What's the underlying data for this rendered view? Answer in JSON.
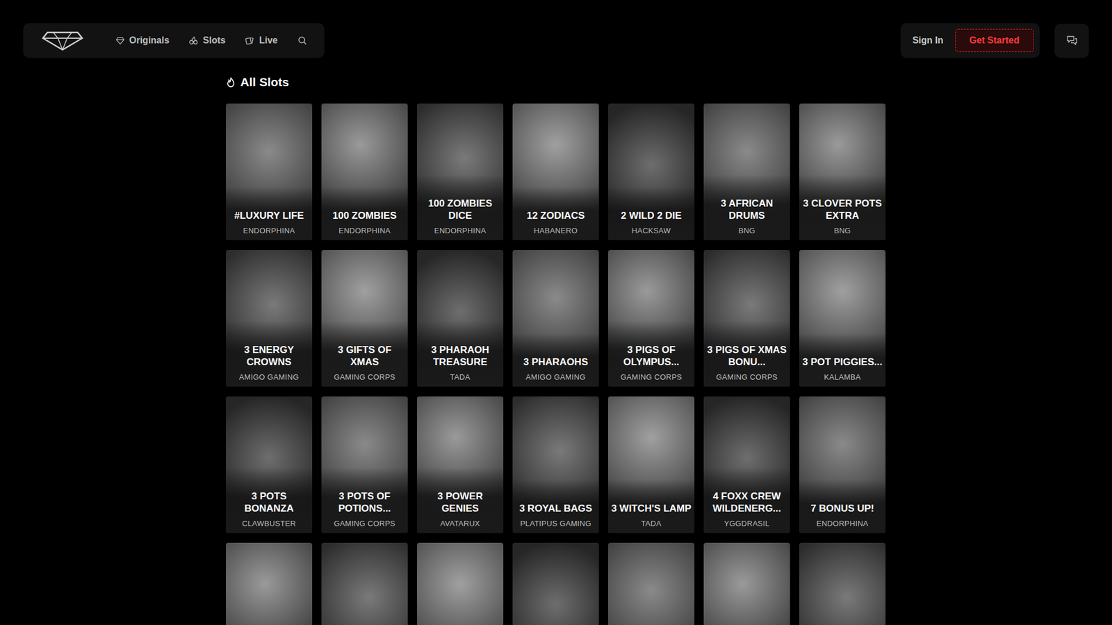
{
  "header": {
    "nav": [
      {
        "label": "Originals",
        "icon": "gem",
        "selected": false
      },
      {
        "label": "Slots",
        "icon": "cherries",
        "selected": false
      },
      {
        "label": "Live",
        "icon": "cards",
        "selected": false
      }
    ],
    "sign_in": "Sign In",
    "get_started": "Get Started"
  },
  "section": {
    "title": "All Slots"
  },
  "cards": [
    {
      "title": "#LUXURY LIFE",
      "provider": "ENDORPHINA"
    },
    {
      "title": "100 ZOMBIES",
      "provider": "ENDORPHINA"
    },
    {
      "title": "100 ZOMBIES DICE",
      "provider": "ENDORPHINA"
    },
    {
      "title": "12 ZODIACS",
      "provider": "HABANERO"
    },
    {
      "title": "2 WILD 2 DIE",
      "provider": "HACKSAW"
    },
    {
      "title": "3 AFRICAN DRUMS",
      "provider": "BNG"
    },
    {
      "title": "3 CLOVER POTS EXTRA",
      "provider": "BNG"
    },
    {
      "title": "3 ENERGY CROWNS",
      "provider": "AMIGO GAMING"
    },
    {
      "title": "3 GIFTS OF XMAS",
      "provider": "GAMING CORPS"
    },
    {
      "title": "3 PHARAOH TREASURE",
      "provider": "TADA"
    },
    {
      "title": "3 PHARAOHS",
      "provider": "AMIGO GAMING"
    },
    {
      "title": "3 PIGS OF OLYMPUS...",
      "provider": "GAMING CORPS"
    },
    {
      "title": "3 PIGS OF XMAS BONU...",
      "provider": "GAMING CORPS"
    },
    {
      "title": "3 POT PIGGIES...",
      "provider": "KALAMBA"
    },
    {
      "title": "3 POTS BONANZA",
      "provider": "CLAWBUSTER"
    },
    {
      "title": "3 POTS OF POTIONS...",
      "provider": "GAMING CORPS"
    },
    {
      "title": "3 POWER GENIES",
      "provider": "AVATARUX"
    },
    {
      "title": "3 ROYAL BAGS",
      "provider": "PLATIPUS GAMING"
    },
    {
      "title": "3 WITCH'S LAMP",
      "provider": "TADA"
    },
    {
      "title": "4 FOXX CREW WILDENERG...",
      "provider": "YGGDRASIL"
    },
    {
      "title": "7 BONUS UP!",
      "provider": "ENDORPHINA"
    },
    {
      "title": "",
      "provider": ""
    },
    {
      "title": "",
      "provider": ""
    },
    {
      "title": "",
      "provider": ""
    },
    {
      "title": "",
      "provider": ""
    },
    {
      "title": "",
      "provider": ""
    },
    {
      "title": "",
      "provider": ""
    },
    {
      "title": "",
      "provider": ""
    }
  ]
}
